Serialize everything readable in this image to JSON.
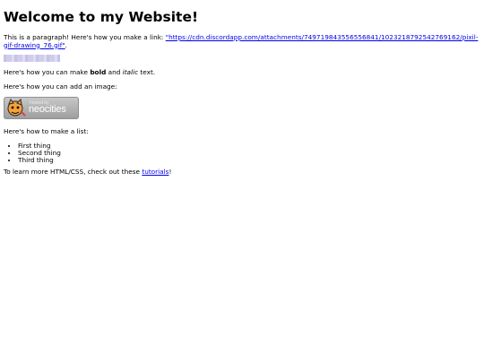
{
  "page": {
    "title": "Welcome to my Website!",
    "intro_text": "This is a paragraph! Here's how you make a link: ",
    "link_text": "\"https://cdn.discordapp.com/attachments/749719843556556841/1023218792542769162/pixil-gif-drawing_76.gif\"",
    "intro_end": ".",
    "bold_prefix": "Here's how you can make ",
    "bold_text": "bold",
    "italic_mid": " and ",
    "italic_text": "italic",
    "italic_end": " text.",
    "image_text": "Here's how you can add an image:",
    "badge_small": "hosted by",
    "badge_big": "neocities",
    "list_intro": "Here's how to make a list:",
    "list_items": [
      "First thing",
      "Second thing",
      "Third thing"
    ],
    "learn_prefix": "To learn more HTML/CSS, check out these ",
    "learn_link": "tutorials",
    "learn_end": "!"
  }
}
